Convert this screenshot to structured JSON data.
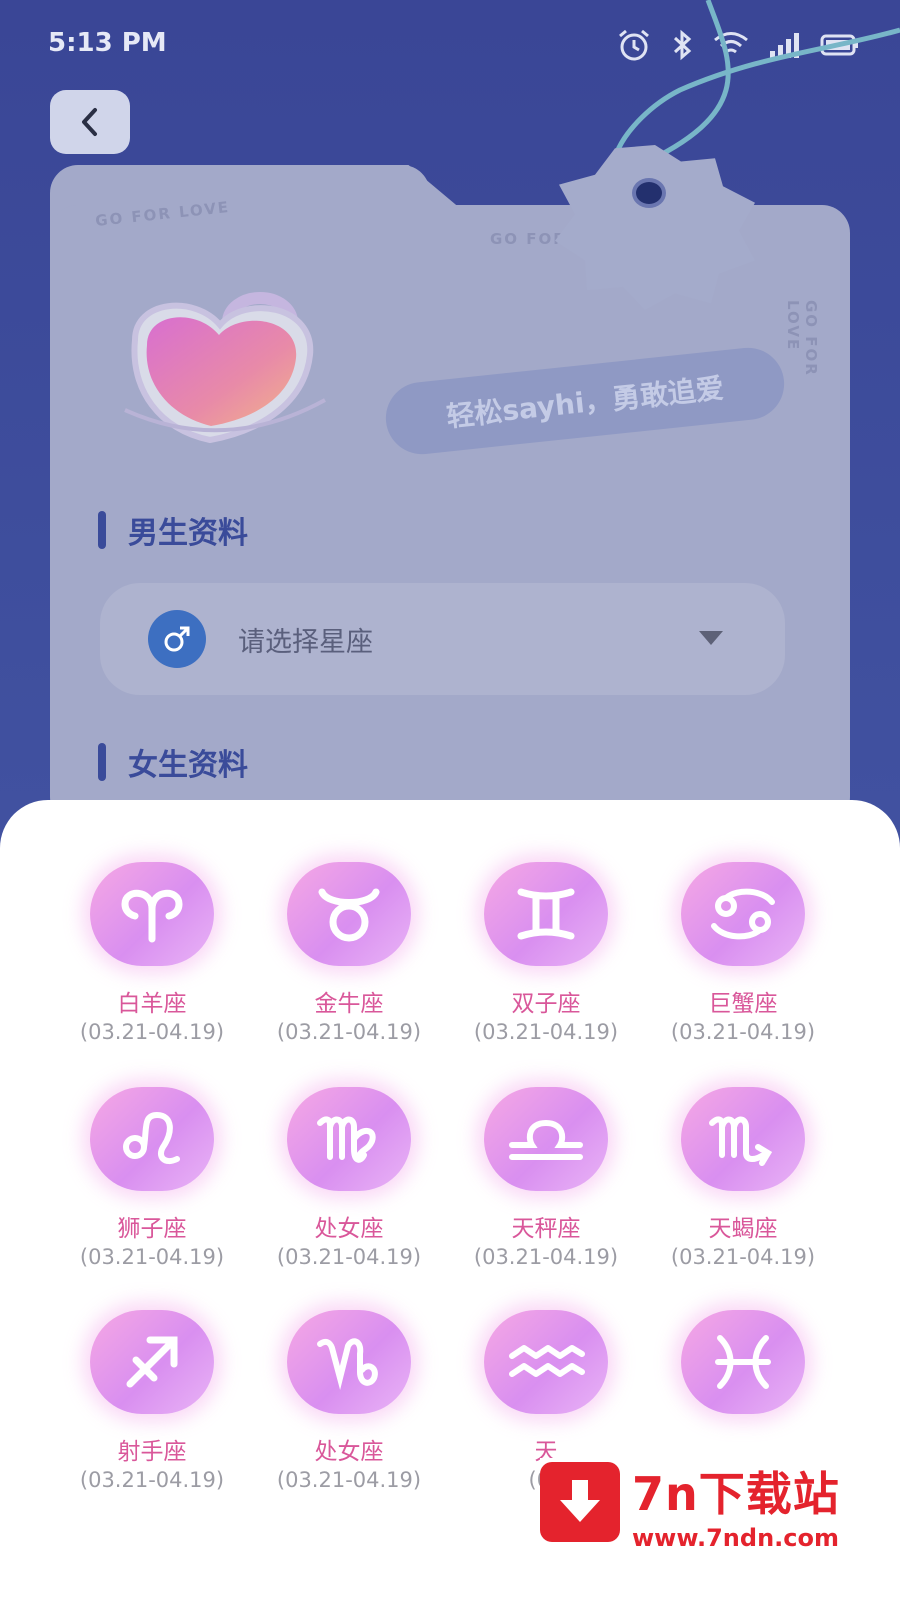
{
  "status": {
    "time": "5:13 PM"
  },
  "card": {
    "deco_text_1": "GO FOR LOVE",
    "deco_text_2": "GO FOR LOVE",
    "deco_text_3": "GO FOR LOVE",
    "slogan": "轻松sayhi，勇敢追爱"
  },
  "male_section": {
    "title": "男生资料",
    "placeholder": "请选择星座"
  },
  "female_section": {
    "title": "女生资料"
  },
  "zodiac": [
    {
      "name": "白羊座",
      "date": "(03.21-04.19)",
      "icon": "aries-icon"
    },
    {
      "name": "金牛座",
      "date": "(03.21-04.19)",
      "icon": "taurus-icon"
    },
    {
      "name": "双子座",
      "date": "(03.21-04.19)",
      "icon": "gemini-icon"
    },
    {
      "name": "巨蟹座",
      "date": "(03.21-04.19)",
      "icon": "cancer-icon"
    },
    {
      "name": "狮子座",
      "date": "(03.21-04.19)",
      "icon": "leo-icon"
    },
    {
      "name": "处女座",
      "date": "(03.21-04.19)",
      "icon": "virgo-icon"
    },
    {
      "name": "天秤座",
      "date": "(03.21-04.19)",
      "icon": "libra-icon"
    },
    {
      "name": "天蝎座",
      "date": "(03.21-04.19)",
      "icon": "scorpio-icon"
    },
    {
      "name": "射手座",
      "date": "(03.21-04.19)",
      "icon": "sagittarius-icon"
    },
    {
      "name": "处女座",
      "date": "(03.21-04.19)",
      "icon": "capricorn-icon"
    },
    {
      "name": "天",
      "date": "(03",
      "icon": "aquarius-icon"
    },
    {
      "name": "",
      "date": "",
      "icon": "pisces-icon"
    }
  ],
  "watermark": {
    "title": "7n下载站",
    "url": "www.7ndn.com"
  },
  "colors": {
    "accent": "#3a4b9a",
    "zodiac_name": "#d9579a",
    "watermark": "#e4232d"
  }
}
